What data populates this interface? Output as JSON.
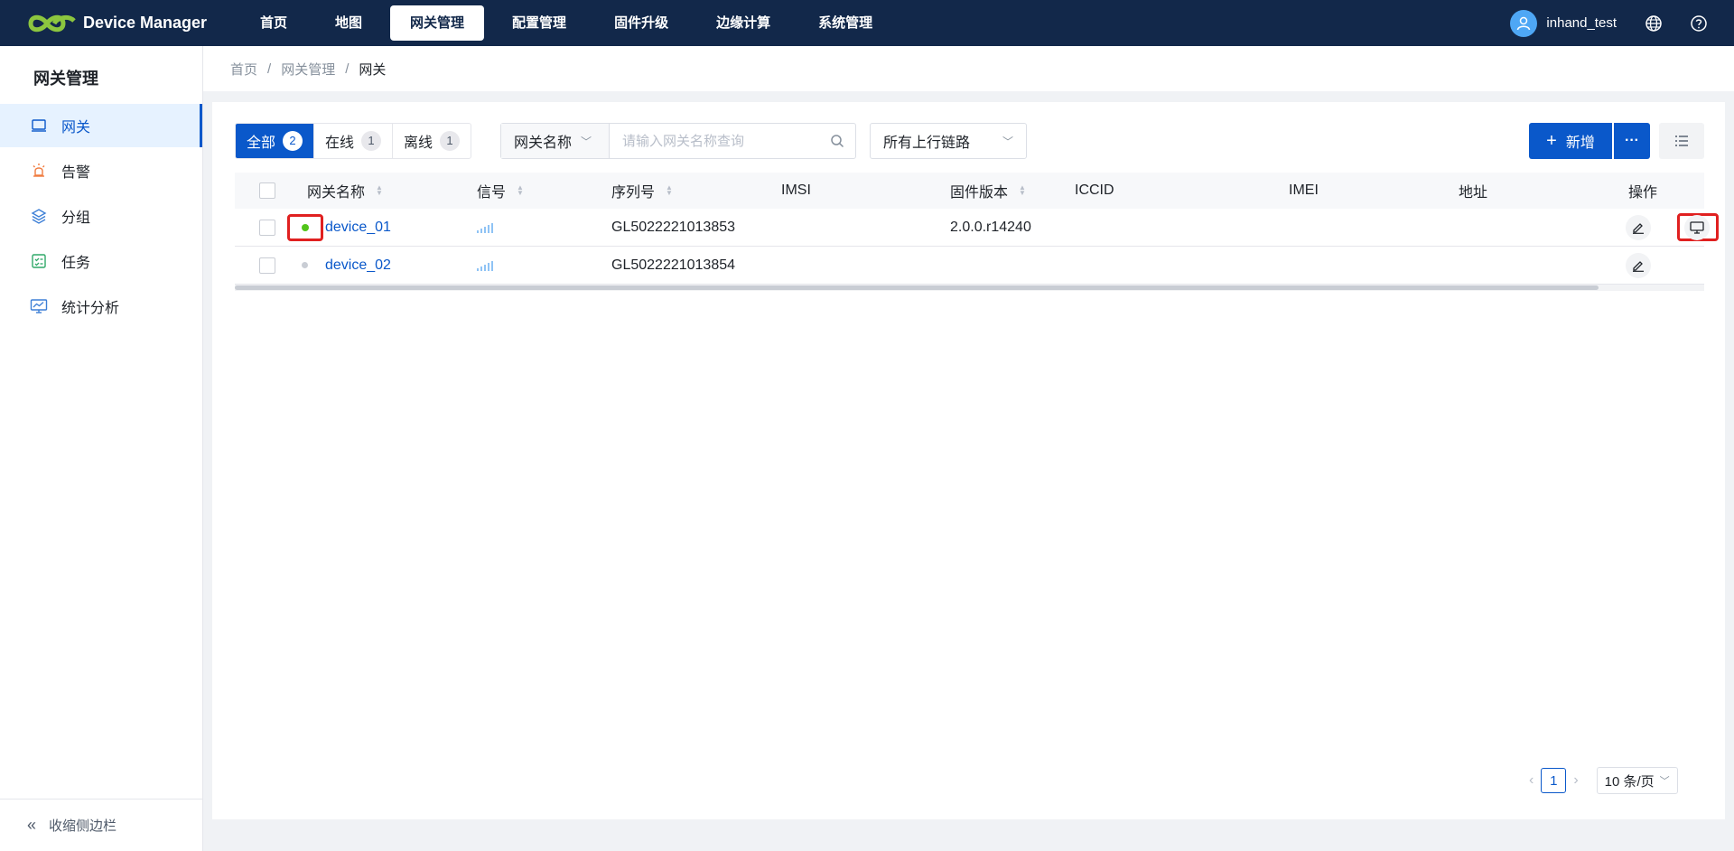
{
  "app": {
    "title": "Device Manager"
  },
  "nav": [
    {
      "label": "首页"
    },
    {
      "label": "地图"
    },
    {
      "label": "网关管理"
    },
    {
      "label": "配置管理"
    },
    {
      "label": "固件升级"
    },
    {
      "label": "边缘计算"
    },
    {
      "label": "系统管理"
    }
  ],
  "user": {
    "name": "inhand_test"
  },
  "sidebar": {
    "title": "网关管理",
    "items": [
      {
        "label": "网关",
        "icon": "gateway-icon"
      },
      {
        "label": "告警",
        "icon": "alarm-icon"
      },
      {
        "label": "分组",
        "icon": "layers-icon"
      },
      {
        "label": "任务",
        "icon": "task-icon"
      },
      {
        "label": "统计分析",
        "icon": "chart-icon"
      }
    ],
    "collapse_label": "收缩侧边栏"
  },
  "breadcrumb": {
    "items": [
      "首页",
      "网关管理",
      "网关"
    ],
    "separator": "/"
  },
  "filters": {
    "tabs": [
      {
        "label": "全部",
        "count": "2"
      },
      {
        "label": "在线",
        "count": "1"
      },
      {
        "label": "离线",
        "count": "1"
      }
    ],
    "search_field": "网关名称",
    "search_placeholder": "请输入网关名称查询",
    "uplink_select": "所有上行链路"
  },
  "toolbar": {
    "add_label": "新增",
    "more_label": "···"
  },
  "table": {
    "headers": {
      "name": "网关名称",
      "signal": "信号",
      "serial": "序列号",
      "imsi": "IMSI",
      "firmware": "固件版本",
      "iccid": "ICCID",
      "imei": "IMEI",
      "address": "地址",
      "actions": "操作"
    },
    "rows": [
      {
        "name": "device_01",
        "status": "online",
        "serial": "GL5022221013853",
        "imsi": "",
        "firmware": "2.0.0.r14240",
        "iccid": "",
        "imei": "",
        "address": ""
      },
      {
        "name": "device_02",
        "status": "offline",
        "serial": "GL5022221013854",
        "imsi": "",
        "firmware": "",
        "iccid": "",
        "imei": "",
        "address": ""
      }
    ]
  },
  "pagination": {
    "current": "1",
    "page_size": "10 条/页"
  },
  "colors": {
    "primary": "#0a58ca",
    "header_bg": "#12284a",
    "online": "#52c41a",
    "offline": "#c9cdd4",
    "highlight": "#e02020"
  }
}
